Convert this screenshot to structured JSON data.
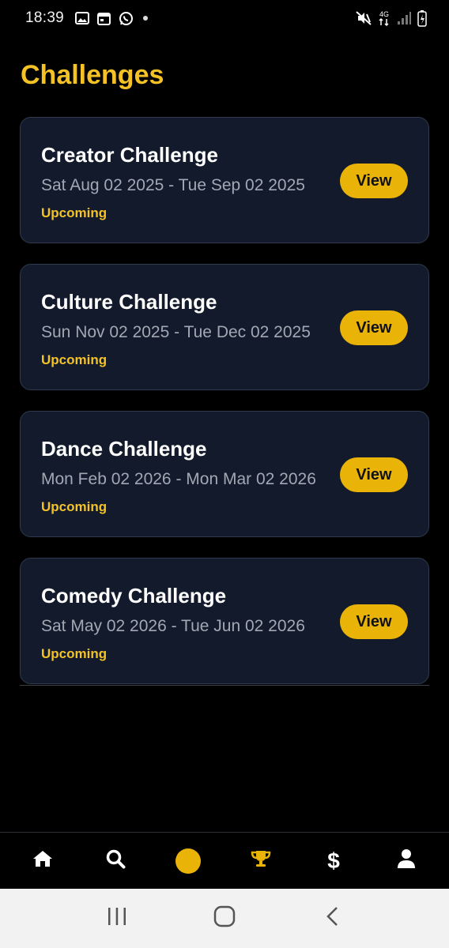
{
  "status_bar": {
    "time": "18:39",
    "left_icons": [
      "gallery-icon",
      "calendar-icon",
      "whatsapp-icon",
      "dot-icon"
    ],
    "right_icons": [
      "mute-icon",
      "4g-icon",
      "signal-icon",
      "battery-icon"
    ],
    "network": "4G"
  },
  "page": {
    "title": "Challenges"
  },
  "challenges": [
    {
      "title": "Creator Challenge",
      "dates": "Sat Aug 02 2025 - Tue Sep 02 2025",
      "status": "Upcoming",
      "button": "View"
    },
    {
      "title": "Culture Challenge",
      "dates": "Sun Nov 02 2025 - Tue Dec 02 2025",
      "status": "Upcoming",
      "button": "View"
    },
    {
      "title": "Dance Challenge",
      "dates": "Mon Feb 02 2026 - Mon Mar 02 2026",
      "status": "Upcoming",
      "button": "View"
    },
    {
      "title": "Comedy Challenge",
      "dates": "Sat May 02 2026 - Tue Jun 02 2026",
      "status": "Upcoming",
      "button": "View"
    }
  ],
  "bottom_nav": {
    "items": [
      "home-icon",
      "search-icon",
      "center-dot",
      "trophy-icon",
      "dollar-icon",
      "profile-icon"
    ],
    "dollar_glyph": "$",
    "active_color": "#eab308"
  },
  "system_nav": [
    "recent-apps-icon",
    "home-button-icon",
    "back-icon"
  ],
  "colors": {
    "background": "#000000",
    "card": "#121a2b",
    "accent": "#f5c226",
    "button": "#eab308"
  }
}
